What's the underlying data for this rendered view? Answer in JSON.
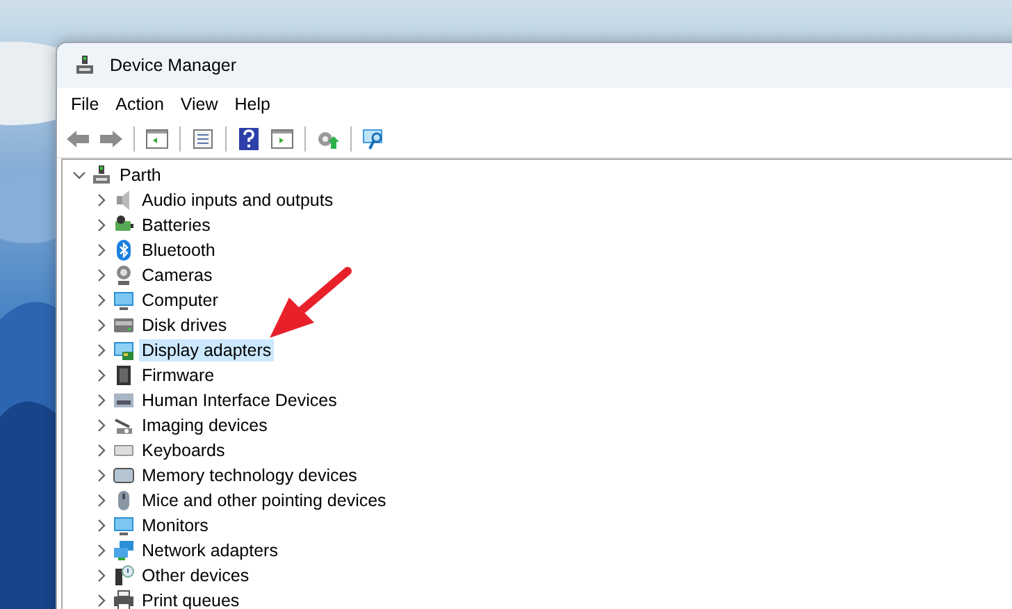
{
  "window": {
    "title": "Device Manager"
  },
  "menu": [
    "File",
    "Action",
    "View",
    "Help"
  ],
  "tree": {
    "label": "Parth",
    "kind": "computer-root",
    "expanded": true,
    "selected": false,
    "children": [
      {
        "label": "Audio inputs and outputs",
        "kind": "audio",
        "expanded": false,
        "selected": false
      },
      {
        "label": "Batteries",
        "kind": "battery",
        "expanded": false,
        "selected": false
      },
      {
        "label": "Bluetooth",
        "kind": "bluetooth",
        "expanded": false,
        "selected": false
      },
      {
        "label": "Cameras",
        "kind": "camera",
        "expanded": false,
        "selected": false
      },
      {
        "label": "Computer",
        "kind": "monitor",
        "expanded": false,
        "selected": false
      },
      {
        "label": "Disk drives",
        "kind": "disk",
        "expanded": false,
        "selected": false
      },
      {
        "label": "Display adapters",
        "kind": "display",
        "expanded": false,
        "selected": true
      },
      {
        "label": "Firmware",
        "kind": "chip",
        "expanded": false,
        "selected": false
      },
      {
        "label": "Human Interface Devices",
        "kind": "hid",
        "expanded": false,
        "selected": false
      },
      {
        "label": "Imaging devices",
        "kind": "scanner",
        "expanded": false,
        "selected": false
      },
      {
        "label": "Keyboards",
        "kind": "keyboard",
        "expanded": false,
        "selected": false
      },
      {
        "label": "Memory technology devices",
        "kind": "memory",
        "expanded": false,
        "selected": false
      },
      {
        "label": "Mice and other pointing devices",
        "kind": "mouse",
        "expanded": false,
        "selected": false
      },
      {
        "label": "Monitors",
        "kind": "monitor",
        "expanded": false,
        "selected": false
      },
      {
        "label": "Network adapters",
        "kind": "network",
        "expanded": false,
        "selected": false
      },
      {
        "label": "Other devices",
        "kind": "other",
        "expanded": false,
        "selected": false
      },
      {
        "label": "Print queues",
        "kind": "printer",
        "expanded": false,
        "selected": false
      }
    ]
  }
}
